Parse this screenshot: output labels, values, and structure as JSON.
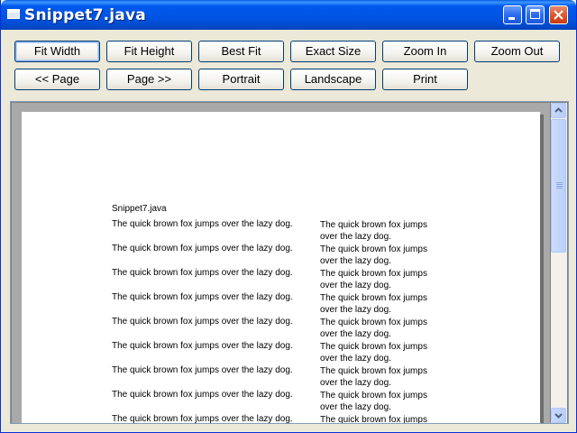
{
  "window": {
    "title": "Snippet7.java"
  },
  "toolbar": {
    "row1": [
      "Fit Width",
      "Fit Height",
      "Best Fit",
      "Exact Size",
      "Zoom In",
      "Zoom Out"
    ],
    "row2": [
      "<< Page",
      "Page >>",
      "Portrait",
      "Landscape",
      "Print"
    ]
  },
  "document": {
    "title": "Snippet7.java",
    "line_text": "The quick brown fox jumps over the lazy dog.",
    "wrapped_first": "The quick brown fox jumps",
    "wrapped_second": "over the lazy dog."
  }
}
